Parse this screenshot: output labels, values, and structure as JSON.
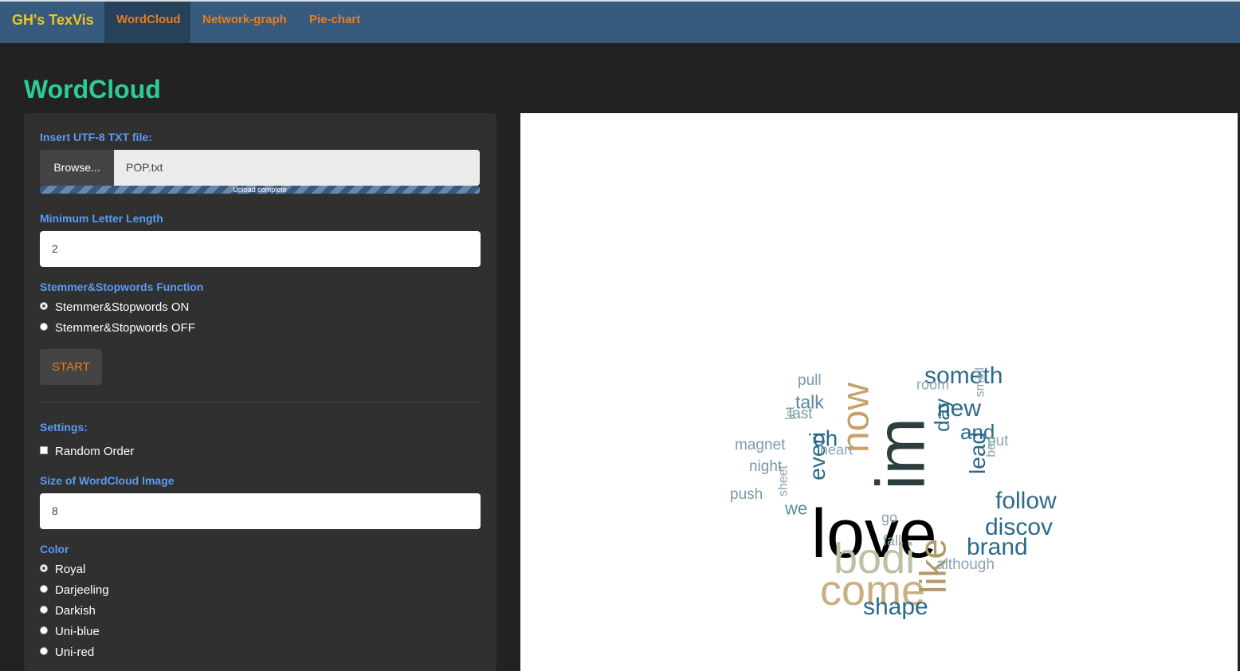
{
  "nav": {
    "brand": "GH's TexVis",
    "tabs": [
      {
        "label": "WordCloud",
        "active": true
      },
      {
        "label": "Network-graph",
        "active": false
      },
      {
        "label": "Pie-chart",
        "active": false
      }
    ]
  },
  "page_title": "WordCloud",
  "sidebar": {
    "file_label": "Insert UTF-8 TXT file:",
    "browse_label": "Browse...",
    "file_name": "POP.txt",
    "upload_status": "Upload complete",
    "upload_progress": 1.0,
    "min_length_label": "Minimum Letter Length",
    "min_length_value": "2",
    "stemmer_label": "Stemmer&Stopwords Function",
    "stemmer_options": [
      {
        "label": "Stemmer&Stopwords ON",
        "checked": true
      },
      {
        "label": "Stemmer&Stopwords OFF",
        "checked": false
      }
    ],
    "start_label": "START",
    "settings_label": "Settings:",
    "random_order_label": "Random Order",
    "random_order_checked": false,
    "size_label": "Size of WordCloud Image",
    "size_value": "8",
    "color_label": "Color",
    "color_options": [
      {
        "label": "Royal",
        "checked": true
      },
      {
        "label": "Darjeeling",
        "checked": false
      },
      {
        "label": "Darkish",
        "checked": false
      },
      {
        "label": "Uni-blue",
        "checked": false
      },
      {
        "label": "Uni-red",
        "checked": false
      }
    ]
  },
  "colors": {
    "navbar": "#375a7f",
    "brand": "#f0c419",
    "nav_link": "#e67e22",
    "title": "#2ecc9a",
    "label": "#5b9bf2"
  },
  "wordcloud": {
    "words": [
      {
        "text": "love",
        "color": "#000000",
        "rotate": false
      },
      {
        "text": "im",
        "color": "#2d3e40",
        "rotate": true
      },
      {
        "text": "bodi",
        "color": "#b9c3a4",
        "rotate": false
      },
      {
        "text": "come",
        "color": "#c8b084",
        "rotate": false
      },
      {
        "text": "now",
        "color": "#c4a36a",
        "rotate": true
      },
      {
        "text": "like",
        "color": "#b09a6a",
        "rotate": true
      },
      {
        "text": "someth",
        "color": "#2a6a8a",
        "rotate": false
      },
      {
        "text": "new",
        "color": "#2a6a8a",
        "rotate": false
      },
      {
        "text": "follow",
        "color": "#2a6a8a",
        "rotate": false
      },
      {
        "text": "discov",
        "color": "#2a6a8a",
        "rotate": false
      },
      {
        "text": "brand",
        "color": "#2a6a8a",
        "rotate": false
      },
      {
        "text": "shape",
        "color": "#2a6a8a",
        "rotate": false
      },
      {
        "text": "and",
        "color": "#2a6a8a",
        "rotate": false
      },
      {
        "text": "oh",
        "color": "#2a6a8a",
        "rotate": false
      },
      {
        "text": "everi",
        "color": "#2a6a8a",
        "rotate": true
      },
      {
        "text": "day",
        "color": "#2a6a8a",
        "rotate": true
      },
      {
        "text": "lead",
        "color": "#2a6a8a",
        "rotate": true
      },
      {
        "text": "talk",
        "color": "#5a8a9c",
        "rotate": false
      },
      {
        "text": "we",
        "color": "#5a8a9c",
        "rotate": false
      },
      {
        "text": "pull",
        "color": "#7a9aa8",
        "rotate": false
      },
      {
        "text": "last",
        "color": "#7a9aa8",
        "rotate": false
      },
      {
        "text": "room",
        "color": "#8aa4b0",
        "rotate": false
      },
      {
        "text": "smell",
        "color": "#8aa4b0",
        "rotate": true
      },
      {
        "text": "let",
        "color": "#8aa4b0",
        "rotate": true
      },
      {
        "text": "magnet",
        "color": "#7a9aa8",
        "rotate": false
      },
      {
        "text": "heart",
        "color": "#8aa4b0",
        "rotate": false
      },
      {
        "text": "put",
        "color": "#8aa4b0",
        "rotate": false
      },
      {
        "text": "bed",
        "color": "#8aa4b0",
        "rotate": true
      },
      {
        "text": "night",
        "color": "#7a9aa8",
        "rotate": false
      },
      {
        "text": "push",
        "color": "#7a9aa8",
        "rotate": false
      },
      {
        "text": "sheet",
        "color": "#8aa4b0",
        "rotate": true
      },
      {
        "text": "go",
        "color": "#8aa4b0",
        "rotate": false
      },
      {
        "text": "fall",
        "color": "#8aa4b0",
        "rotate": false
      },
      {
        "text": "although",
        "color": "#8aa4b0",
        "rotate": false
      }
    ]
  }
}
